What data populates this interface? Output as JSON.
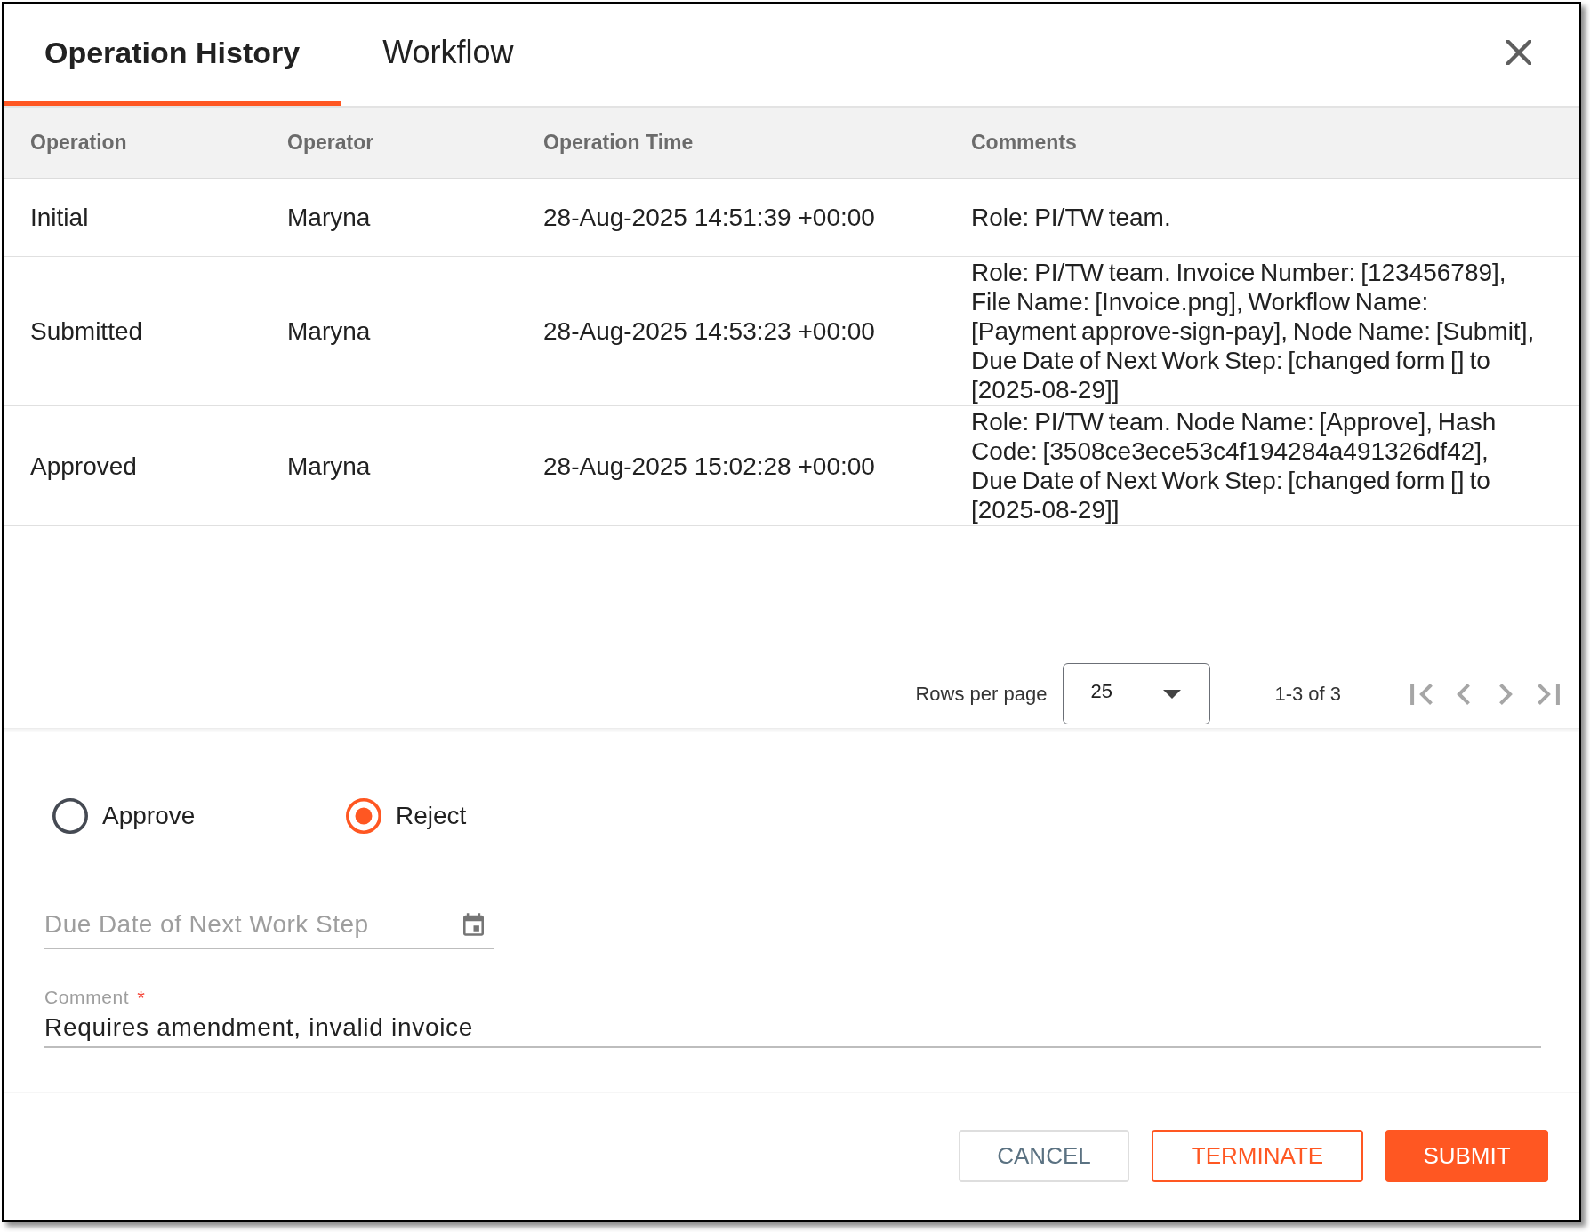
{
  "tabs": [
    {
      "label": "Operation History",
      "selected": true
    },
    {
      "label": "Workflow",
      "selected": false
    }
  ],
  "table": {
    "columns": [
      "Operation",
      "Operator",
      "Operation Time",
      "Comments"
    ],
    "rows": [
      {
        "operation": "Initial",
        "operator": "Maryna",
        "operation_time": "28-Aug-2025 14:51:39 +00:00",
        "comments": "Role: PI/TW team."
      },
      {
        "operation": "Submitted",
        "operator": "Maryna",
        "operation_time": "28-Aug-2025 14:53:23 +00:00",
        "comments": "Role: PI/TW team. Invoice Number: [123456789], File Name: [Invoice.png], Workflow Name: [Payment approve-sign-pay], Node Name: [Submit], Due Date of Next Work Step: [changed form [] to [2025-08-29]]"
      },
      {
        "operation": "Approved",
        "operator": "Maryna",
        "operation_time": "28-Aug-2025 15:02:28 +00:00",
        "comments": "Role: PI/TW team. Node Name: [Approve], Hash Code: [3508ce3ece53c4f194284a491326df42], Due Date of Next Work Step: [changed form [] to [2025-08-29]]"
      }
    ]
  },
  "pagination": {
    "rows_per_page_label": "Rows per page",
    "rows_per_page": "25",
    "range": "1-3 of 3",
    "nav": [
      {
        "kind": "first",
        "disabled": true
      },
      {
        "kind": "previous",
        "disabled": true
      },
      {
        "kind": "next",
        "disabled": true
      },
      {
        "kind": "last",
        "disabled": true
      }
    ]
  },
  "decision": {
    "options": [
      {
        "label": "Approve",
        "selected": false
      },
      {
        "label": "Reject",
        "selected": true
      }
    ]
  },
  "due_date": {
    "placeholder": "Due Date of Next Work Step"
  },
  "comment": {
    "label": "Comment",
    "required_mark": "*",
    "value": "Requires amendment, invalid invoice"
  },
  "buttons": [
    {
      "label": "CANCEL",
      "kind": "plain"
    },
    {
      "label": "TERMINATE",
      "kind": "outline"
    },
    {
      "label": "SUBMIT",
      "kind": "filled"
    }
  ]
}
